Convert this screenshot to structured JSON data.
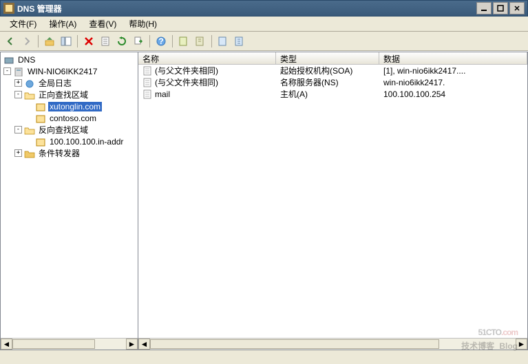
{
  "title": "DNS 管理器",
  "menu": {
    "file": "文件(F)",
    "action": "操作(A)",
    "view": "查看(V)",
    "help": "帮助(H)"
  },
  "tree": {
    "root": "DNS",
    "server": "WIN-NIO6IKK2417",
    "global_log": "全局日志",
    "fwd_zone": "正向查找区域",
    "zone1": "xutonglin.com",
    "zone2": "contoso.com",
    "rev_zone": "反向查找区域",
    "rev1": "100.100.100.in-addr",
    "cond_fwd": "条件转发器"
  },
  "columns": {
    "name": "名称",
    "type": "类型",
    "data": "数据"
  },
  "records": [
    {
      "name": "(与父文件夹相同)",
      "type": "起始授权机构(SOA)",
      "data": "[1], win-nio6ikk2417...."
    },
    {
      "name": "(与父文件夹相同)",
      "type": "名称服务器(NS)",
      "data": "win-nio6ikk2417."
    },
    {
      "name": "mail",
      "type": "主机(A)",
      "data": "100.100.100.254"
    }
  ],
  "watermark": {
    "site": "51CTO",
    "dot": ".com",
    "sub": "技术博客",
    "blog": "Blog"
  }
}
